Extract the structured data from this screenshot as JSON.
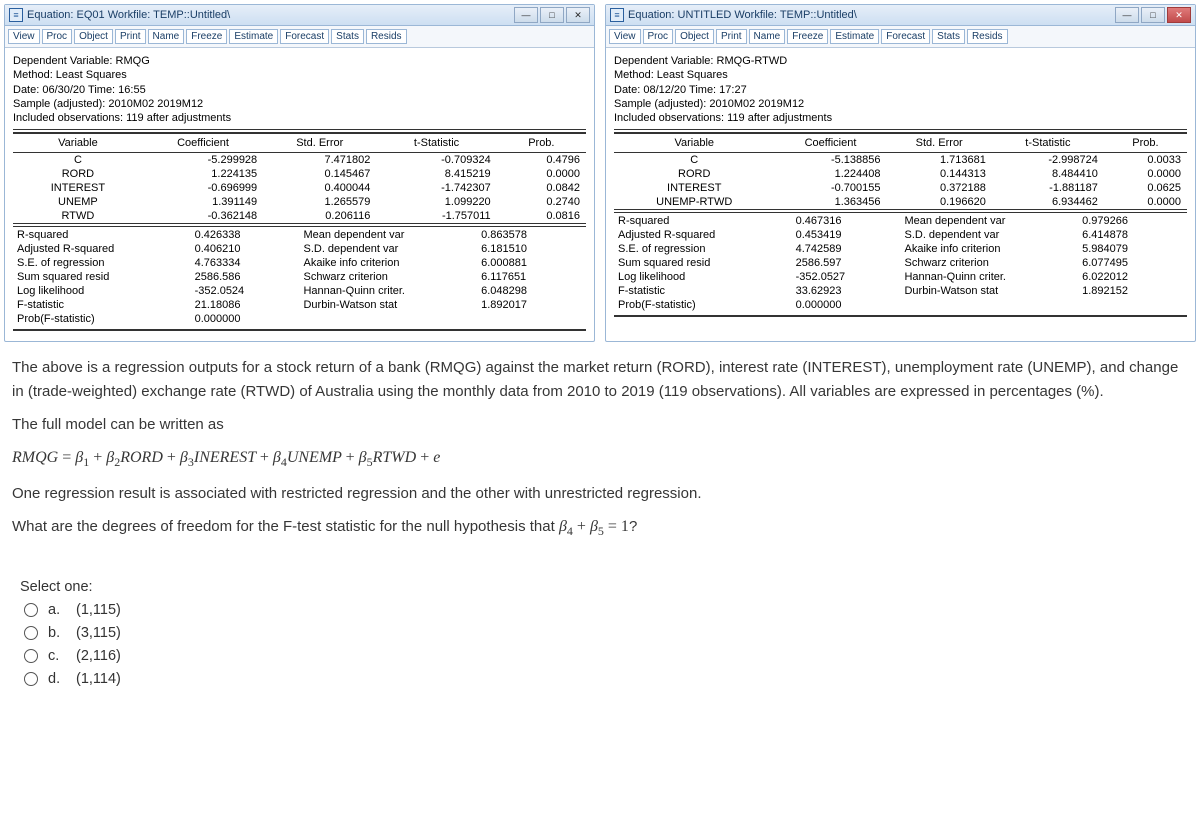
{
  "windows": [
    {
      "title": "Equation: EQ01   Workfile: TEMP::Untitled\\",
      "toolbar": [
        "View",
        "Proc",
        "Object",
        "Print",
        "Name",
        "Freeze",
        "Estimate",
        "Forecast",
        "Stats",
        "Resids"
      ],
      "head": [
        "Dependent Variable: RMQG",
        "Method: Least Squares",
        "Date: 06/30/20   Time: 16:55",
        "Sample (adjusted): 2010M02 2019M12",
        "Included observations: 119 after adjustments"
      ],
      "coef_headers": [
        "Variable",
        "Coefficient",
        "Std. Error",
        "t-Statistic",
        "Prob."
      ],
      "coef_rows": [
        [
          "C",
          "-5.299928",
          "7.471802",
          "-0.709324",
          "0.4796"
        ],
        [
          "RORD",
          "1.224135",
          "0.145467",
          "8.415219",
          "0.0000"
        ],
        [
          "INTEREST",
          "-0.696999",
          "0.400044",
          "-1.742307",
          "0.0842"
        ],
        [
          "UNEMP",
          "1.391149",
          "1.265579",
          "1.099220",
          "0.2740"
        ],
        [
          "RTWD",
          "-0.362148",
          "0.206116",
          "-1.757011",
          "0.0816"
        ]
      ],
      "stats": [
        [
          "R-squared",
          "0.426338",
          "Mean dependent var",
          "0.863578"
        ],
        [
          "Adjusted R-squared",
          "0.406210",
          "S.D. dependent var",
          "6.181510"
        ],
        [
          "S.E. of regression",
          "4.763334",
          "Akaike info criterion",
          "6.000881"
        ],
        [
          "Sum squared resid",
          "2586.586",
          "Schwarz criterion",
          "6.117651"
        ],
        [
          "Log likelihood",
          "-352.0524",
          "Hannan-Quinn criter.",
          "6.048298"
        ],
        [
          "F-statistic",
          "21.18086",
          "Durbin-Watson stat",
          "1.892017"
        ],
        [
          "Prob(F-statistic)",
          "0.000000",
          "",
          ""
        ]
      ],
      "close_red": false
    },
    {
      "title": "Equation: UNTITLED   Workfile: TEMP::Untitled\\",
      "toolbar": [
        "View",
        "Proc",
        "Object",
        "Print",
        "Name",
        "Freeze",
        "Estimate",
        "Forecast",
        "Stats",
        "Resids"
      ],
      "head": [
        "Dependent Variable: RMQG-RTWD",
        "Method: Least Squares",
        "Date: 08/12/20   Time: 17:27",
        "Sample (adjusted): 2010M02 2019M12",
        "Included observations: 119 after adjustments"
      ],
      "coef_headers": [
        "Variable",
        "Coefficient",
        "Std. Error",
        "t-Statistic",
        "Prob."
      ],
      "coef_rows": [
        [
          "C",
          "-5.138856",
          "1.713681",
          "-2.998724",
          "0.0033"
        ],
        [
          "RORD",
          "1.224408",
          "0.144313",
          "8.484410",
          "0.0000"
        ],
        [
          "INTEREST",
          "-0.700155",
          "0.372188",
          "-1.881187",
          "0.0625"
        ],
        [
          "UNEMP-RTWD",
          "1.363456",
          "0.196620",
          "6.934462",
          "0.0000"
        ]
      ],
      "stats": [
        [
          "R-squared",
          "0.467316",
          "Mean dependent var",
          "0.979266"
        ],
        [
          "Adjusted R-squared",
          "0.453419",
          "S.D. dependent var",
          "6.414878"
        ],
        [
          "S.E. of regression",
          "4.742589",
          "Akaike info criterion",
          "5.984079"
        ],
        [
          "Sum squared resid",
          "2586.597",
          "Schwarz criterion",
          "6.077495"
        ],
        [
          "Log likelihood",
          "-352.0527",
          "Hannan-Quinn criter.",
          "6.022012"
        ],
        [
          "F-statistic",
          "33.62923",
          "Durbin-Watson stat",
          "1.892152"
        ],
        [
          "Prob(F-statistic)",
          "0.000000",
          "",
          ""
        ]
      ],
      "close_red": true
    }
  ],
  "question": {
    "p1": "The above is a regression outputs for a stock return of a bank (RMQG) against the market return (RORD), interest rate (INTEREST), unemployment rate (UNEMP), and change in (trade-weighted) exchange rate (RTWD) of Australia using the monthly data from 2010 to 2019 (119 observations). All variables are expressed in percentages (%).",
    "p2": "The full model can be written as",
    "eq_plain": "RMQG = β1 + β2 RORD + β3 INEREST + β4 UNEMP + β5 RTWD + e",
    "p3": "One regression result is associated with restricted regression and the other with unrestricted regression.",
    "p4_prefix": "What are the degrees of freedom for the  F-test statistic for the null hypothesis that ",
    "p4_hyp": "β4 + β5 = 1",
    "p4_suffix": "?"
  },
  "answers": {
    "header": "Select one:",
    "options": [
      {
        "letter": "a.",
        "text": "(1,115)"
      },
      {
        "letter": "b.",
        "text": "(3,115)"
      },
      {
        "letter": "c.",
        "text": "(2,116)"
      },
      {
        "letter": "d.",
        "text": "(1,114)"
      }
    ]
  },
  "icons": {
    "minimize": "—",
    "maximize": "□",
    "close": "✕",
    "eq": "≡"
  }
}
